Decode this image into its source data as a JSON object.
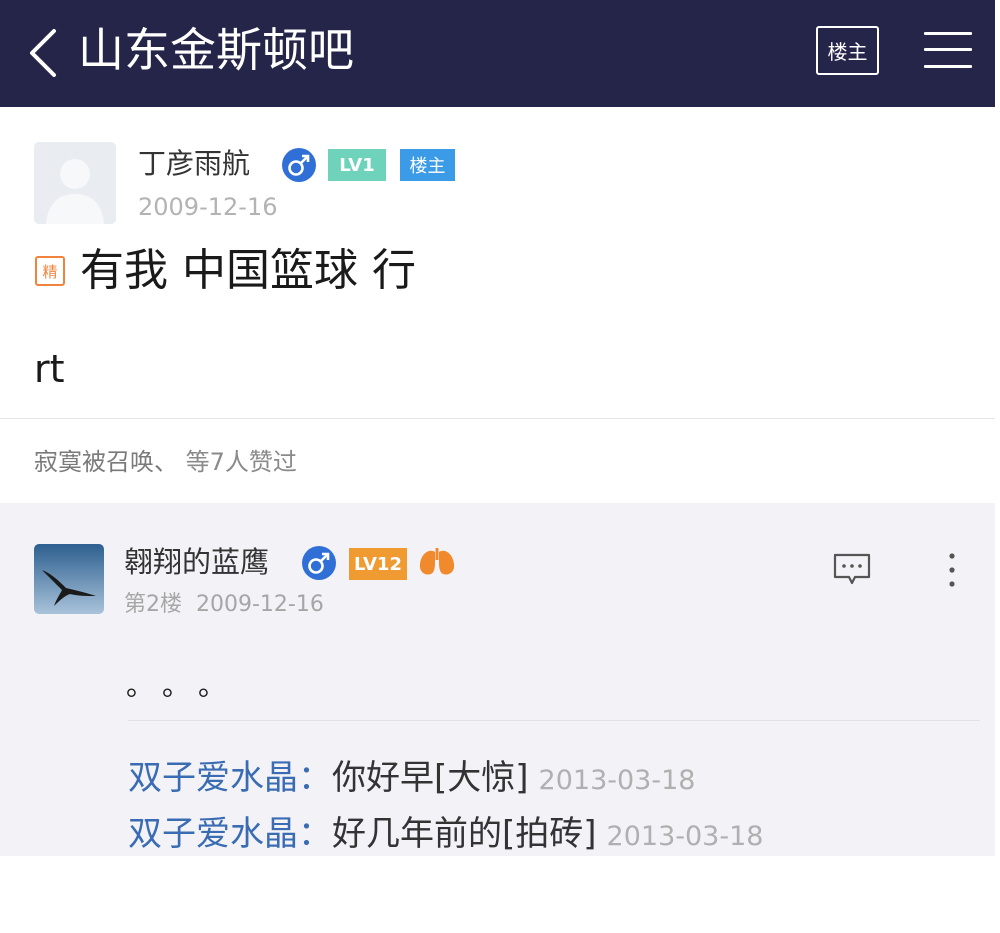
{
  "header": {
    "title": "山东金斯顿吧",
    "owner_button": "楼主"
  },
  "op": {
    "username": "丁彦雨航",
    "level": "LV1",
    "owner_badge": "楼主",
    "date": "2009-12-16",
    "essence_badge": "精",
    "title": "有我 中国篮球 行",
    "body": "rt",
    "likes": {
      "liker": "寂寞被召唤、",
      "text": "等7人赞过"
    }
  },
  "reply": {
    "username": "翱翔的蓝鹰",
    "level": "LV12",
    "floor": "第2楼",
    "date": "2009-12-16",
    "body": "。。。",
    "sub_replies": [
      {
        "author": "双子爱水晶",
        "colon": "：",
        "text": "你好早[大惊]",
        "date": "2013-03-18"
      },
      {
        "author": "双子爱水晶",
        "colon": "：",
        "text": "好几年前的[拍砖]",
        "date": "2013-03-18"
      }
    ]
  },
  "colors": {
    "header_bg": "#25254a",
    "level1": "#6fd3bc",
    "level12": "#f09a32",
    "owner_badge": "#3c9be6",
    "gender": "#2f6fd6",
    "sub_author": "#3a6cb3"
  }
}
